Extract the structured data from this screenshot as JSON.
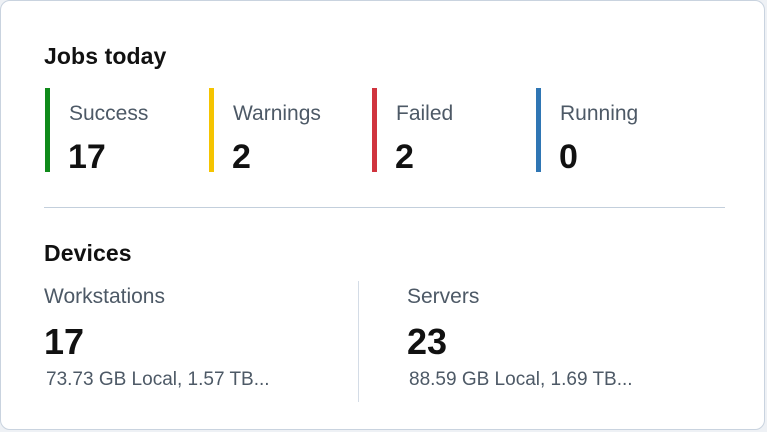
{
  "jobs": {
    "title": "Jobs today",
    "stats": [
      {
        "label": "Success",
        "value": "17",
        "color": "#0f8a1a"
      },
      {
        "label": "Warnings",
        "value": "2",
        "color": "#f5c400"
      },
      {
        "label": "Failed",
        "value": "2",
        "color": "#d0343e"
      },
      {
        "label": "Running",
        "value": "0",
        "color": "#2f76b4"
      }
    ]
  },
  "devices": {
    "title": "Devices",
    "items": [
      {
        "label": "Workstations",
        "value": "17",
        "storage": "73.73 GB Local, 1.57 TB..."
      },
      {
        "label": "Servers",
        "value": "23",
        "storage": "88.59 GB Local, 1.69 TB..."
      }
    ]
  }
}
